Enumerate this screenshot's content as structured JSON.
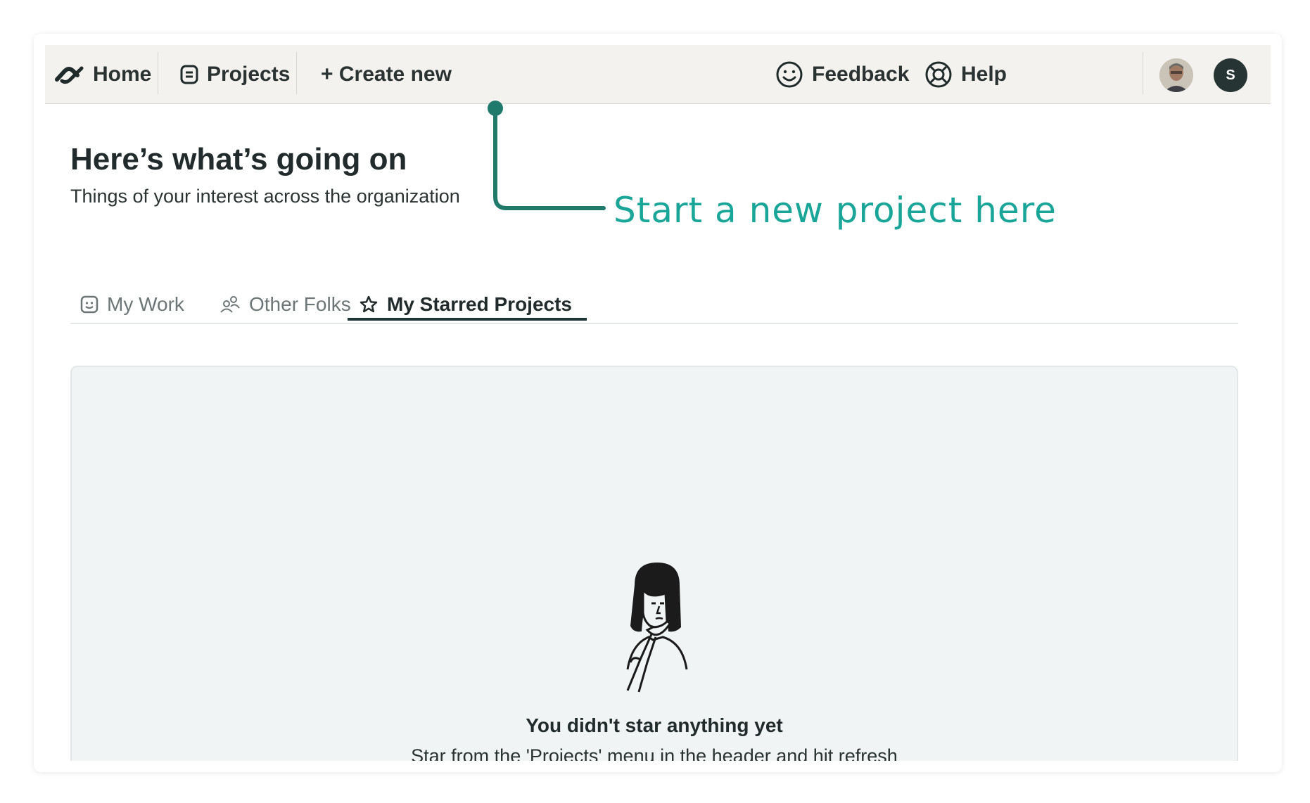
{
  "nav": {
    "home_label": "Home",
    "projects_label": "Projects",
    "create_label": "+ Create new",
    "feedback_label": "Feedback",
    "help_label": "Help",
    "user_initial": "S"
  },
  "page": {
    "title": "Here’s what’s going on",
    "subtitle": "Things of your interest across the organization"
  },
  "tabs": [
    {
      "label": "My Work",
      "icon": "smiley-square-icon",
      "active": false
    },
    {
      "label": "Other Folks",
      "icon": "people-icon",
      "active": false
    },
    {
      "label": "My Starred Projects",
      "icon": "star-icon",
      "active": true
    }
  ],
  "empty_state": {
    "title": "You didn't star anything yet",
    "subtitle": "Star from the 'Projects' menu in the header and hit refresh"
  },
  "annotation": {
    "text": "Start a new project here",
    "color": "#19a699",
    "line_color": "#1f7a6c"
  },
  "colors": {
    "header_bg": "#f4f2ee",
    "panel_bg": "#f1f4f4",
    "active_tab_underline": "#1f3434"
  }
}
